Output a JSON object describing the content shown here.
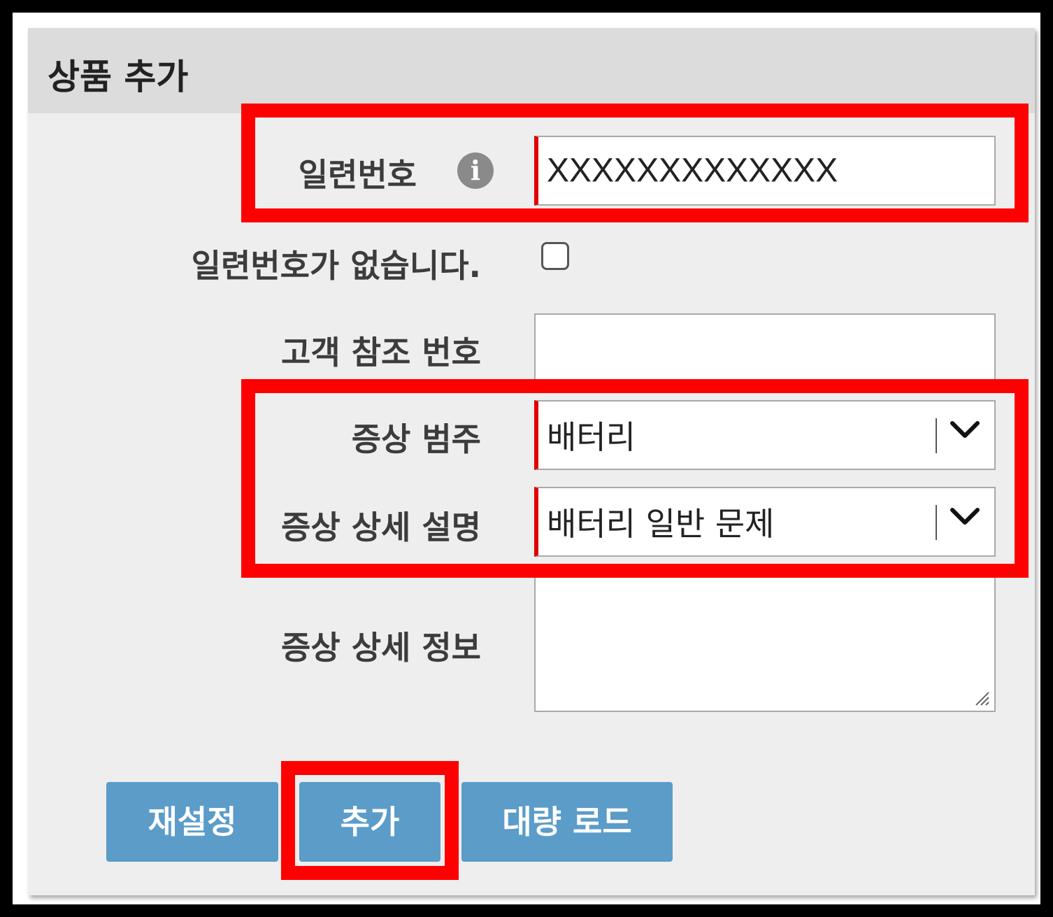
{
  "panel": {
    "title": "상품 추가"
  },
  "form": {
    "serial": {
      "label": "일련번호",
      "value": "XXXXXXXXXXXXX"
    },
    "no_serial": {
      "label": "일련번호가 없습니다.",
      "checked": false
    },
    "customer_ref": {
      "label": "고객 참조 번호",
      "value": ""
    },
    "symptom_category": {
      "label": "증상 범주",
      "value": "배터리"
    },
    "symptom_detail_desc": {
      "label": "증상 상세 설명",
      "value": "배터리 일반 문제"
    },
    "symptom_detail_info": {
      "label": "증상 상세 정보",
      "value": ""
    }
  },
  "buttons": {
    "reset": "재설정",
    "add": "추가",
    "bulk_load": "대량 로드"
  },
  "colors": {
    "highlight": "#ff0000",
    "required_marker": "#e00000",
    "button": "#5b9cc9",
    "header": "#dcdcdc",
    "panel": "#eeeeee"
  }
}
